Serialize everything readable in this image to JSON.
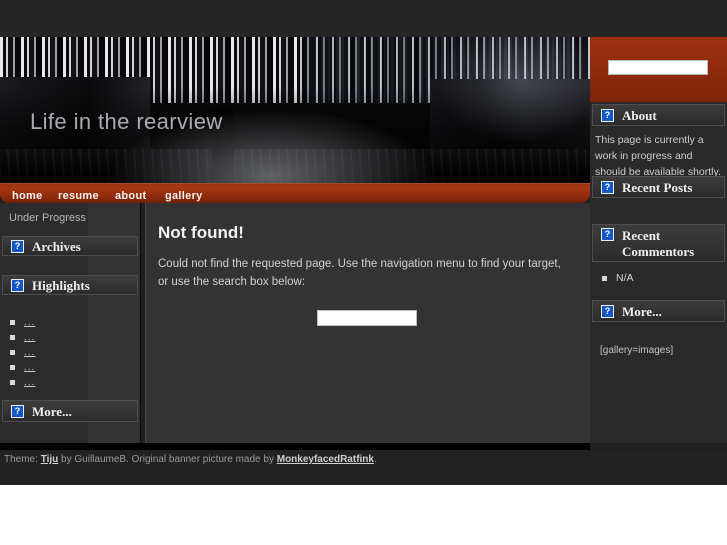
{
  "site": {
    "title": "Life in the rearview"
  },
  "top_search": {
    "value": "",
    "placeholder": ""
  },
  "nav": {
    "items": [
      {
        "label": "home"
      },
      {
        "label": "resume"
      },
      {
        "label": "about"
      },
      {
        "label": "gallery"
      }
    ]
  },
  "left_sidebar": {
    "status": "Under Progress",
    "widgets": {
      "archives": {
        "title": "Archives",
        "icon": "broken-image-icon",
        "icon_glyph": "?"
      },
      "highlights": {
        "title": "Highlights",
        "icon": "broken-image-icon",
        "icon_glyph": "?"
      },
      "more": {
        "title": "More...",
        "icon": "broken-image-icon",
        "icon_glyph": "?"
      }
    },
    "highlight_links": [
      {
        "label": "..."
      },
      {
        "label": "..."
      },
      {
        "label": "..."
      },
      {
        "label": "..."
      },
      {
        "label": "..."
      }
    ]
  },
  "main": {
    "heading": "Not found!",
    "body": "Could not find the requested page. Use the navigation menu to find your target, or use the search box below:",
    "search": {
      "value": "",
      "placeholder": ""
    }
  },
  "right_sidebar": {
    "widgets": {
      "about": {
        "title": "About",
        "icon": "broken-image-icon",
        "icon_glyph": "?"
      },
      "recent_posts": {
        "title": "Recent Posts",
        "icon": "broken-image-icon",
        "icon_glyph": "?"
      },
      "recent_commentors": {
        "title": "Recent Commentors",
        "icon": "broken-image-icon",
        "icon_glyph": "?"
      },
      "more": {
        "title": "More...",
        "icon": "broken-image-icon",
        "icon_glyph": "?"
      }
    },
    "about_text": "This page is currently a work in progress and should be available shortly.",
    "commentors": [
      {
        "label": "N/A"
      }
    ],
    "gallery_shortcode": "[gallery=images]"
  },
  "footer": {
    "prefix": "Theme: ",
    "theme_link": "Tiju",
    "middle": " by GuillaumeB. Original banner picture made by ",
    "credit_link": "MonkeyfacedRatfink",
    "suffix": "."
  },
  "colors": {
    "accent_red": "#9e3211",
    "page_bg": "#1f1f1f",
    "panel_bg": "#2c2c2c",
    "main_bg": "#333333",
    "icon_blue": "#1257c4"
  }
}
